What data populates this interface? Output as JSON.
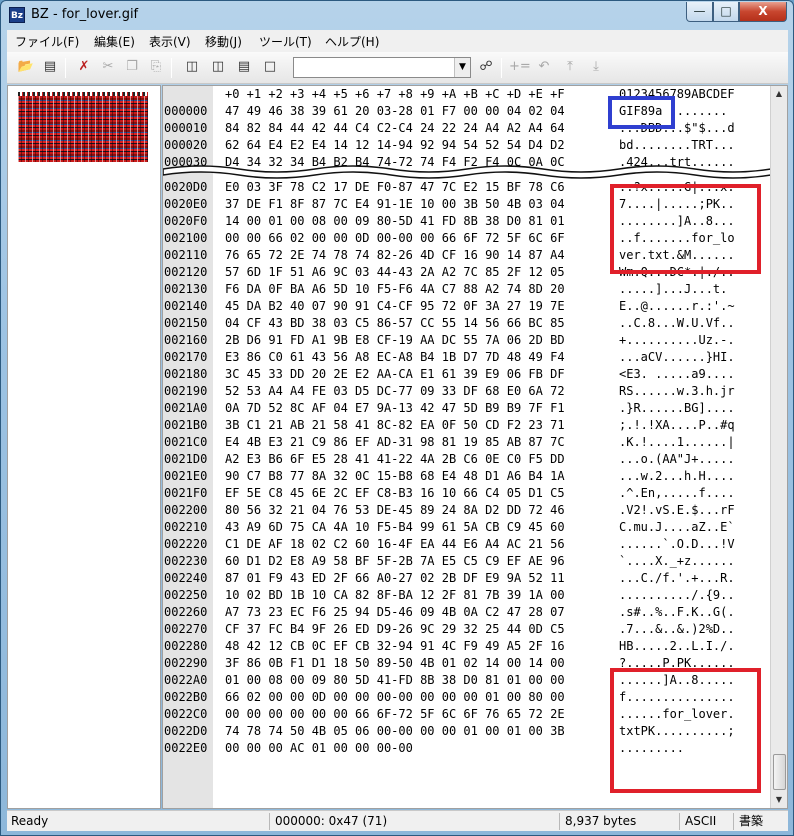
{
  "window": {
    "title": "BZ - for_lover.gif",
    "app_icon": "Bz",
    "min": "—",
    "max": "□",
    "close": "X"
  },
  "menu": [
    "ファイル(F)",
    "編集(E)",
    "表示(V)",
    "移動(J)",
    "ツール(T)",
    "ヘルプ(H)"
  ],
  "toolbar": {
    "icons": [
      "open-folder-icon",
      "save-icon",
      "cut-special-icon",
      "cut-icon",
      "copy-icon",
      "paste-icon",
      "view-hex-icon",
      "view-split-vertical-icon",
      "view-split-horizontal-icon",
      "view-single-icon",
      "binoculars-icon",
      "insert-icon",
      "undo-icon",
      "jump-top-icon",
      "jump-bottom-icon"
    ],
    "combo_value": ""
  },
  "hex": {
    "header_hex": "+0 +1 +2 +3 +4 +5 +6 +7 +8 +9 +A +B +C +D +E +F",
    "header_ascii": "0123456789ABCDEF",
    "top_rows": [
      {
        "off": "000000",
        "hex": "47 49 46 38 39 61 20 03-28 01 F7 00 00 04 02 04",
        "asc": "GIF89a (......."
      },
      {
        "off": "000010",
        "hex": "84 82 84 44 42 44 C4 C2-C4 24 22 24 A4 A2 A4 64",
        "asc": "...DBD...$\"$...d"
      },
      {
        "off": "000020",
        "hex": "62 64 E4 E2 E4 14 12 14-94 92 94 54 52 54 D4 D2",
        "asc": "bd........TRT..."
      },
      {
        "off": "000030",
        "hex": "D4 34 32 34 B4 B2 B4 74-72 74 F4 F2 F4 0C 0A 0C",
        "asc": ".424...trt......"
      }
    ],
    "rows": [
      {
        "off": "0020D0",
        "hex": "E0 03 3F 78 C2 17 DE F0-87 47 7C E2 15 BF 78 C6",
        "asc": "..?x.....G|...x."
      },
      {
        "off": "0020E0",
        "hex": "37 DE F1 8F 87 7C E4 91-1E 10 00 3B 50 4B 03 04",
        "asc": "7....|.....;PK.."
      },
      {
        "off": "0020F0",
        "hex": "14 00 01 00 08 00 09 80-5D 41 FD 8B 38 D0 81 01",
        "asc": "........]A..8..."
      },
      {
        "off": "002100",
        "hex": "00 00 66 02 00 00 0D 00-00 00 66 6F 72 5F 6C 6F",
        "asc": "..f.......for_lo"
      },
      {
        "off": "002110",
        "hex": "76 65 72 2E 74 78 74 82-26 4D CF 16 90 14 87 A4",
        "asc": "ver.txt.&M......"
      },
      {
        "off": "002120",
        "hex": "57 6D 1F 51 A6 9C 03 44-43 2A A2 7C 85 2F 12 05",
        "asc": "Wm.Q...DC*.|./.."
      },
      {
        "off": "002130",
        "hex": "F6 DA 0F BA A6 5D 10 F5-F6 4A C7 88 A2 74 8D 20",
        "asc": ".....]...J...t. "
      },
      {
        "off": "002140",
        "hex": "45 DA B2 40 07 90 91 C4-CF 95 72 0F 3A 27 19 7E",
        "asc": "E..@......r.:'.~"
      },
      {
        "off": "002150",
        "hex": "04 CF 43 BD 38 03 C5 86-57 CC 55 14 56 66 BC 85",
        "asc": "..C.8...W.U.Vf.."
      },
      {
        "off": "002160",
        "hex": "2B D6 91 FD A1 9B E8 CF-19 AA DC 55 7A 06 2D BD",
        "asc": "+..........Uz.-."
      },
      {
        "off": "002170",
        "hex": "E3 86 C0 61 43 56 A8 EC-A8 B4 1B D7 7D 48 49 F4",
        "asc": "...aCV......}HI."
      },
      {
        "off": "002180",
        "hex": "3C 45 33 DD 20 2E E2 AA-CA E1 61 39 E9 06 FB DF",
        "asc": "<E3. .....a9...."
      },
      {
        "off": "002190",
        "hex": "52 53 A4 A4 FE 03 D5 DC-77 09 33 DF 68 E0 6A 72",
        "asc": "RS......w.3.h.jr"
      },
      {
        "off": "0021A0",
        "hex": "0A 7D 52 8C AF 04 E7 9A-13 42 47 5D B9 B9 7F F1",
        "asc": ".}R......BG]...."
      },
      {
        "off": "0021B0",
        "hex": "3B C1 21 AB 21 58 41 8C-82 EA 0F 50 CD F2 23 71",
        "asc": ";.!.!XA....P..#q"
      },
      {
        "off": "0021C0",
        "hex": "E4 4B E3 21 C9 86 EF AD-31 98 81 19 85 AB 87 7C",
        "asc": ".K.!....1......|"
      },
      {
        "off": "0021D0",
        "hex": "A2 E3 B6 6F E5 28 41 41-22 4A 2B C6 0E C0 F5 DD",
        "asc": "...o.(AA\"J+....."
      },
      {
        "off": "0021E0",
        "hex": "90 C7 B8 77 8A 32 0C 15-B8 68 E4 48 D1 A6 B4 1A",
        "asc": "...w.2...h.H...."
      },
      {
        "off": "0021F0",
        "hex": "EF 5E C8 45 6E 2C EF C8-B3 16 10 66 C4 05 D1 C5",
        "asc": ".^.En,.....f...."
      },
      {
        "off": "002200",
        "hex": "80 56 32 21 04 76 53 DE-45 89 24 8A D2 DD 72 46",
        "asc": ".V2!.vS.E.$...rF"
      },
      {
        "off": "002210",
        "hex": "43 A9 6D 75 CA 4A 10 F5-B4 99 61 5A CB C9 45 60",
        "asc": "C.mu.J....aZ..E`"
      },
      {
        "off": "002220",
        "hex": "C1 DE AF 18 02 C2 60 16-4F EA 44 E6 A4 AC 21 56",
        "asc": "......`.O.D...!V"
      },
      {
        "off": "002230",
        "hex": "60 D1 D2 E8 A9 58 BF 5F-2B 7A E5 C5 C9 EF AE 96",
        "asc": "`....X._+z......"
      },
      {
        "off": "002240",
        "hex": "87 01 F9 43 ED 2F 66 A0-27 02 2B DF E9 9A 52 11",
        "asc": "...C./f.'.+...R."
      },
      {
        "off": "002250",
        "hex": "10 02 BD 1B 10 CA 82 8F-BA 12 2F 81 7B 39 1A 00",
        "asc": "........../.{9.."
      },
      {
        "off": "002260",
        "hex": "A7 73 23 EC F6 25 94 D5-46 09 4B 0A C2 47 28 07",
        "asc": ".s#..%..F.K..G(."
      },
      {
        "off": "002270",
        "hex": "CF 37 FC B4 9F 26 ED D9-26 9C 29 32 25 44 0D C5",
        "asc": ".7...&..&.)2%D.."
      },
      {
        "off": "002280",
        "hex": "48 42 12 CB 0C EF CB 32-94 91 4C F9 49 A5 2F 16",
        "asc": "HB.....2..L.I./."
      },
      {
        "off": "002290",
        "hex": "3F 86 0B F1 D1 18 50 89-50 4B 01 02 14 00 14 00",
        "asc": "?.....P.PK......"
      },
      {
        "off": "0022A0",
        "hex": "01 00 08 00 09 80 5D 41-FD 8B 38 D0 81 01 00 00",
        "asc": "......]A..8....."
      },
      {
        "off": "0022B0",
        "hex": "66 02 00 00 0D 00 00 00-00 00 00 00 01 00 80 00",
        "asc": "f..............."
      },
      {
        "off": "0022C0",
        "hex": "00 00 00 00 00 00 66 6F-72 5F 6C 6F 76 65 72 2E",
        "asc": "......for_lover."
      },
      {
        "off": "0022D0",
        "hex": "74 78 74 50 4B 05 06 00-00 00 00 01 00 01 00 3B",
        "asc": "txtPK..........;"
      },
      {
        "off": "0022E0",
        "hex": "00 00 00 AC 01 00 00 00-00",
        "asc": "........."
      }
    ]
  },
  "status": {
    "ready": "Ready",
    "position": "000000: 0x47 (71)",
    "size": "8,937 bytes",
    "encoding": "ASCII",
    "mode": "書築"
  },
  "colors": {
    "blue_highlight": "#2f3fd0",
    "red_highlight": "#e0202a"
  }
}
